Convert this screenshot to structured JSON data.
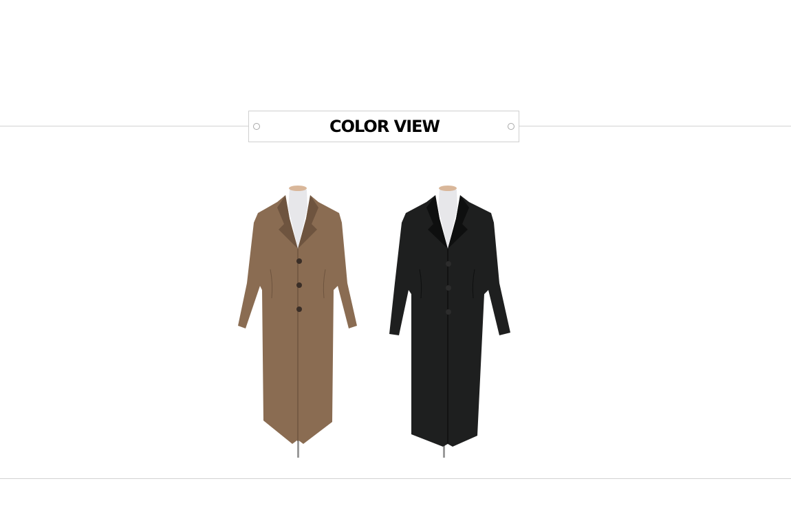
{
  "section": {
    "title": "COLOR VIEW"
  },
  "products": [
    {
      "color_name": "brown",
      "fill": "#8a6c52",
      "shade": "#6e543f",
      "button": "#3a2e27"
    },
    {
      "color_name": "black",
      "fill": "#1e1f1f",
      "shade": "#0e0f0f",
      "button": "#2c2c2c"
    }
  ],
  "colors": {
    "divider": "#d2d2d2",
    "title_border": "#cfcfcf",
    "text": "#000000",
    "mannequin_neck": "#e7e7ea",
    "mannequin_cap": "#d9b79a",
    "mannequin_stand": "#9a9a9a"
  }
}
